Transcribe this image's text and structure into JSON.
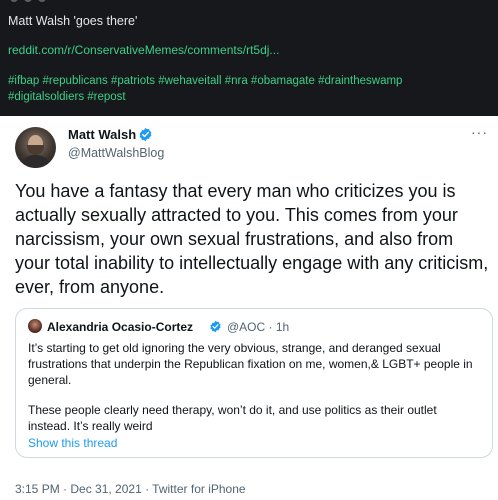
{
  "reddit_post": {
    "title": "Matt Walsh 'goes there'",
    "link": "reddit.com/r/ConservativeMemes/comments/rt5dj...",
    "hashtags_line1": "#ifbap #republicans #patriots #wehaveitall #nra #obamagate #draintheswamp",
    "hashtags_line2": "#digitalsoldiers #repost"
  },
  "tweet": {
    "author_name": "Matt Walsh",
    "author_handle": "@MattWalshBlog",
    "more_icon": "more-dots-icon",
    "text": "You have a fantasy that every man who criticizes you is actually sexually attracted to you. This comes from your narcissism, your own sexual frustrations, and also from your total inability to intellectually engage with any criticism, ever, from anyone.",
    "timestamp": "3:15 PM · Dec 31, 2021 · Twitter for iPhone"
  },
  "quoted_tweet": {
    "author_name": "Alexandria Ocasio-Cortez",
    "handle_time": "@AOC · 1h",
    "text_para1": "It’s starting to get old ignoring the very obvious, strange, and deranged sexual frustrations that underpin the Republican fixation on me, women,& LGBT+ people in general.",
    "text_para2": "These people clearly need therapy, won’t do it, and use politics as their outlet instead. It’s really weird",
    "show_thread": "Show this thread"
  },
  "colors": {
    "banner_bg": "#16181b",
    "link_green": "#3ecf86",
    "twitter_blue": "#1d9bf0",
    "secondary_text": "#536471"
  }
}
